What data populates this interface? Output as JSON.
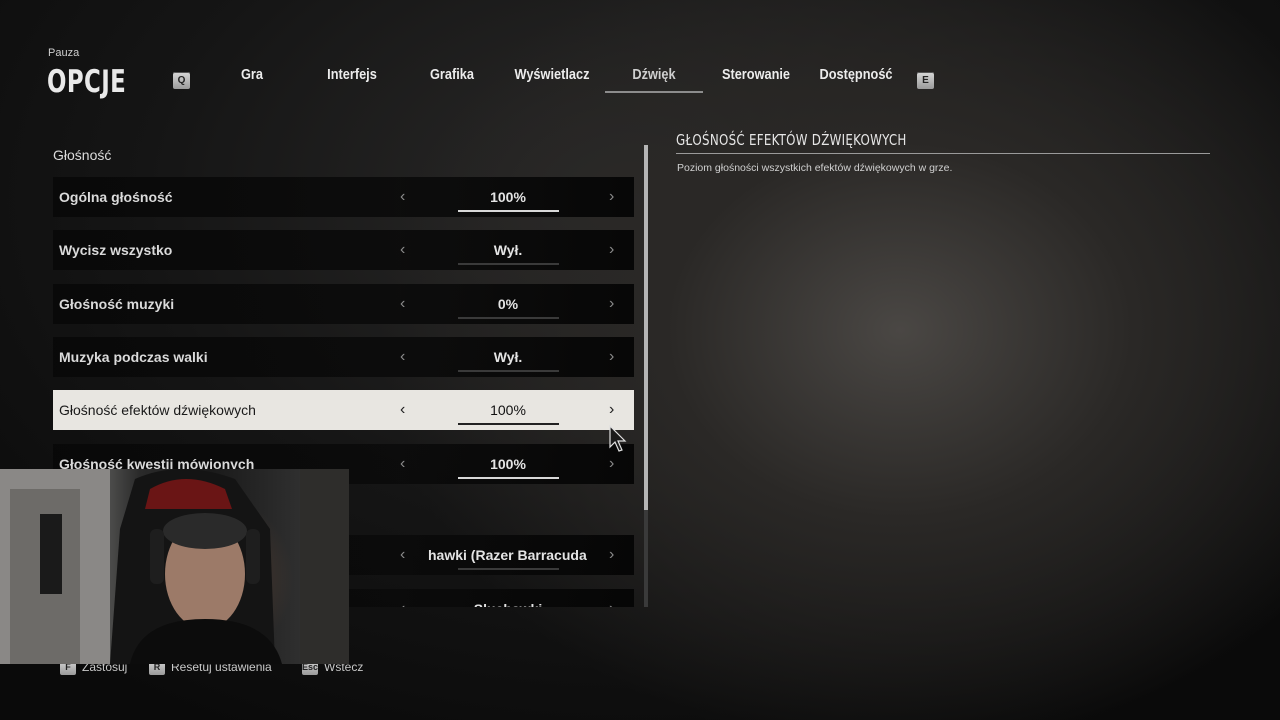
{
  "header": {
    "pause_label": "Pauza",
    "title": "OPCJE",
    "prev_key": "Q",
    "next_key": "E"
  },
  "tabs": [
    {
      "label": "Gra",
      "active": false
    },
    {
      "label": "Interfejs",
      "active": false
    },
    {
      "label": "Grafika",
      "active": false
    },
    {
      "label": "Wyświetlacz",
      "active": false
    },
    {
      "label": "Dźwięk",
      "active": true
    },
    {
      "label": "Sterowanie",
      "active": false
    },
    {
      "label": "Dostępność",
      "active": false
    }
  ],
  "section": {
    "title": "Głośność"
  },
  "settings": [
    {
      "label": "Ogólna głośność",
      "value": "100%",
      "level": 1.0
    },
    {
      "label": "Wycisz wszystko",
      "value": "Wył.",
      "level": 0
    },
    {
      "label": "Głośność muzyki",
      "value": "0%",
      "level": 0
    },
    {
      "label": "Muzyka podczas walki",
      "value": "Wył.",
      "level": 0
    },
    {
      "label": "Głośność efektów dźwiękowych",
      "value": "100%",
      "level": 1.0,
      "selected": true
    },
    {
      "label": "Głośność kwestii mówionych",
      "value": "100%",
      "level": 1.0
    },
    {
      "label": "",
      "value": "hawki (Razer Barracuda X Ch",
      "level": 0
    },
    {
      "label": "",
      "value": "Słuchawki",
      "level": 0
    }
  ],
  "description": {
    "title": "GŁOŚNOŚĆ EFEKTÓW DŹWIĘKOWYCH",
    "text": "Poziom głośności wszystkich efektów dźwiękowych w grze."
  },
  "footer": {
    "apply": {
      "key": "F",
      "label": "Zastosuj"
    },
    "reset": {
      "key": "R",
      "label": "Resetuj ustawienia"
    },
    "back": {
      "key": "Esc",
      "label": "Wstecz"
    }
  },
  "colors": {
    "selected_bg": "#e8e6e1",
    "row_bg": "#0a0a0a",
    "accent": "#d8d8d8"
  },
  "icons": {
    "left": "chevron-left-icon",
    "right": "chevron-right-icon",
    "cursor": "mouse-cursor-icon"
  }
}
